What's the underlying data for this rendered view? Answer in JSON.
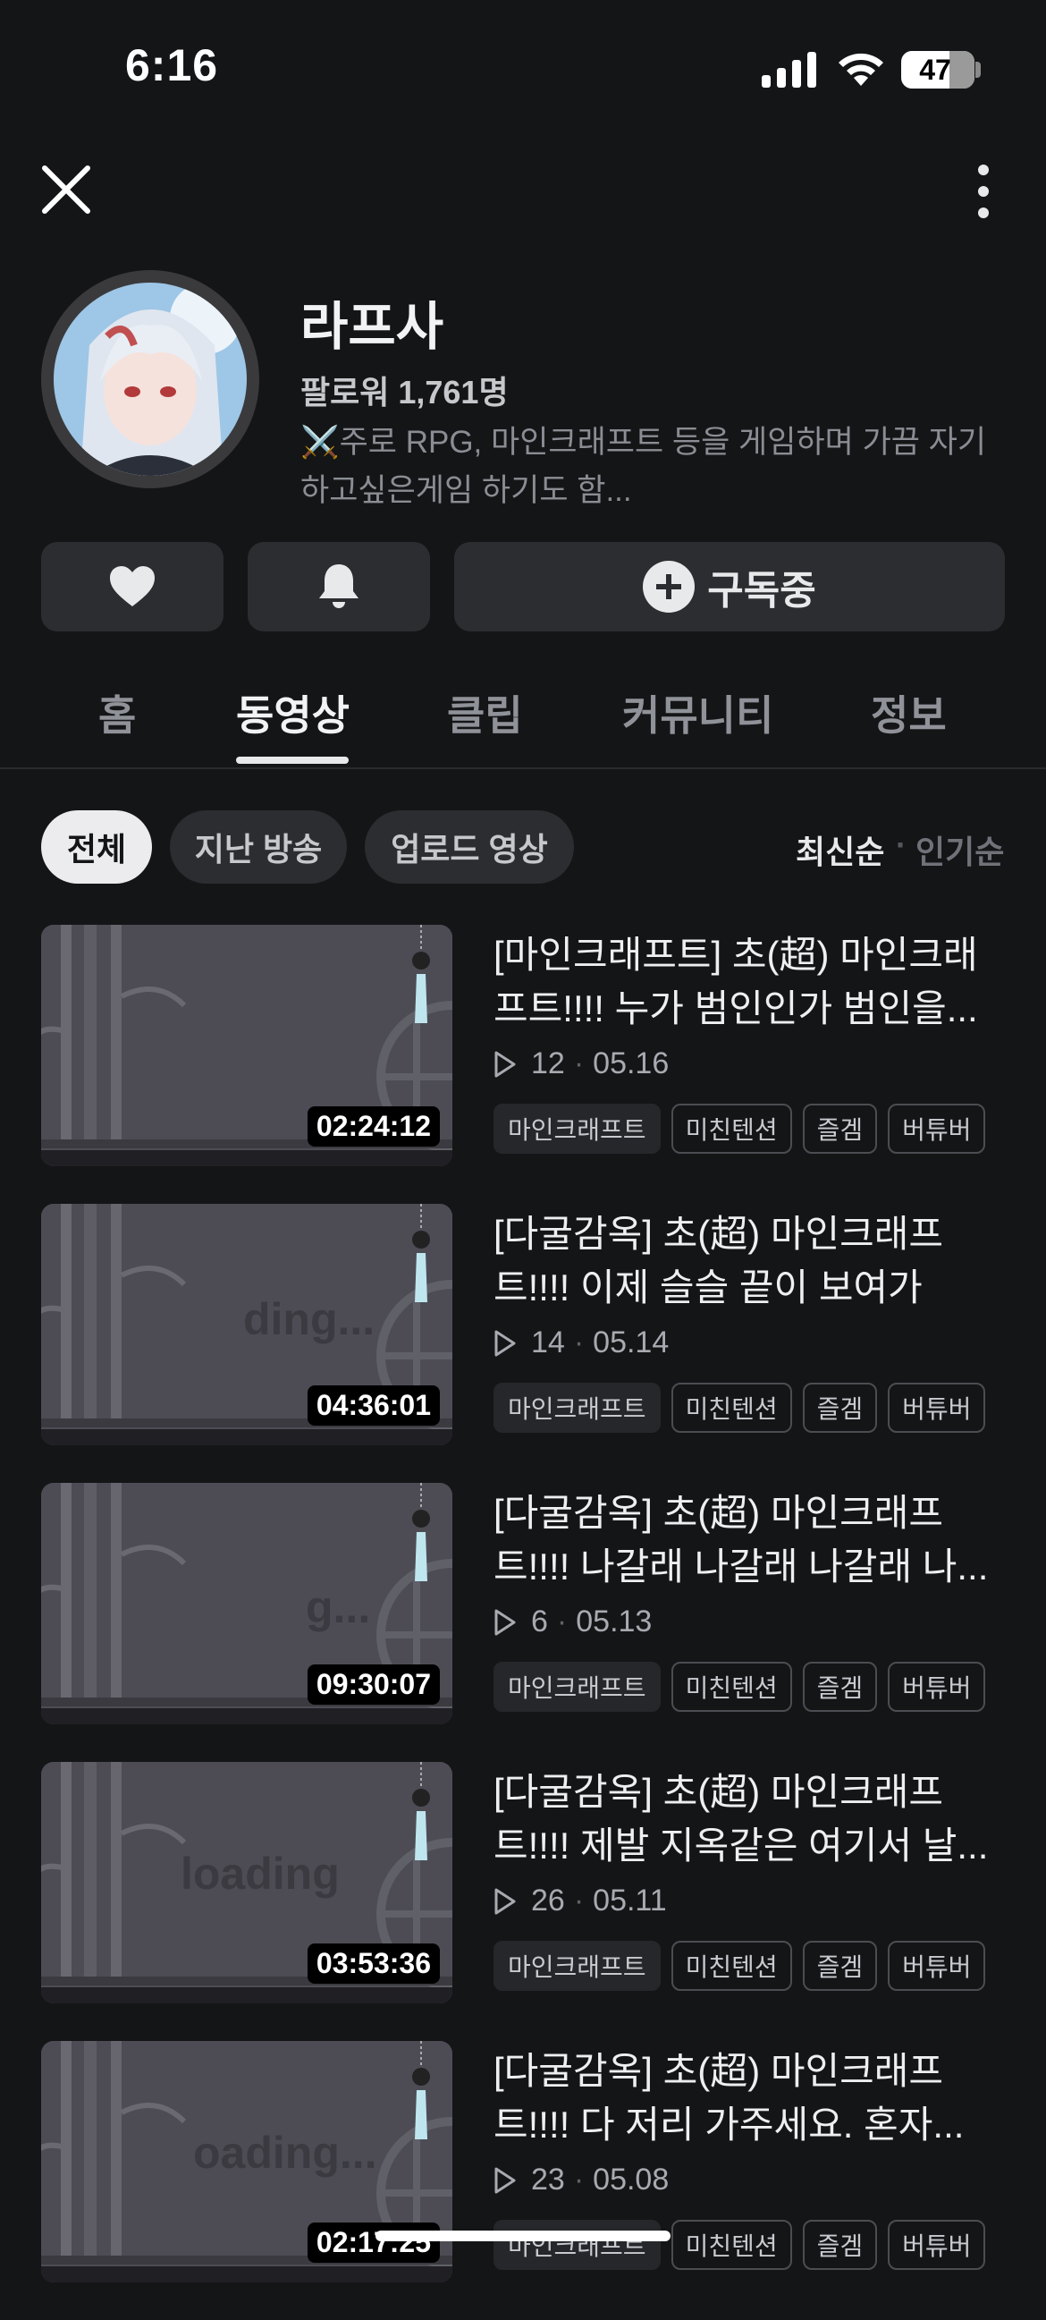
{
  "status": {
    "time": "6:16",
    "battery": "47"
  },
  "channel": {
    "name": "라프사",
    "followers": "팔로워 1,761명",
    "description": "⚔️주로 RPG, 마인크래프트 등을 게임하며 가끔 자기 하고싶은게임 하기도 함..."
  },
  "actions": {
    "subscribe_label": "구독중"
  },
  "tabs": [
    "홈",
    "동영상",
    "클립",
    "커뮤니티",
    "정보"
  ],
  "active_tab": "동영상",
  "filters": [
    "전체",
    "지난 방송",
    "업로드 영상"
  ],
  "sort": {
    "newest": "최신순",
    "separator": "·",
    "popular": "인기순"
  },
  "videos": [
    {
      "title": "[마인크래프트] 초(超) 마인크래프트!!!! 누가 범인인가 범인을...",
      "views": "12",
      "date": "05.16",
      "duration": "02:24:12",
      "overlay": "",
      "tags": [
        "마인크래프트",
        "미친텐션",
        "즐겜",
        "버튜버"
      ]
    },
    {
      "title": "[다굴감옥] 초(超) 마인크래프트!!!! 이제 슬슬 끝이 보여가 희...",
      "views": "14",
      "date": "05.14",
      "duration": "04:36:01",
      "overlay": "ding...",
      "tags": [
        "마인크래프트",
        "미친텐션",
        "즐겜",
        "버튜버"
      ]
    },
    {
      "title": "[다굴감옥] 초(超) 마인크래프트!!!! 나갈래 나갈래 나갈래 나...",
      "views": "6",
      "date": "05.13",
      "duration": "09:30:07",
      "overlay": "g...",
      "tags": [
        "마인크래프트",
        "미친텐션",
        "즐겜",
        "버튜버"
      ]
    },
    {
      "title": "[다굴감옥] 초(超) 마인크래프트!!!! 제발 지옥같은 여기서 날...",
      "views": "26",
      "date": "05.11",
      "duration": "03:53:36",
      "overlay": "loading",
      "tags": [
        "마인크래프트",
        "미친텐션",
        "즐겜",
        "버튜버"
      ]
    },
    {
      "title": "[다굴감옥] 초(超) 마인크래프트!!!! 다 저리 가주세요. 혼자...",
      "views": "23",
      "date": "05.08",
      "duration": "02:17:25",
      "overlay": "oading...",
      "tags": [
        "마인크래프트",
        "미친텐션",
        "즐겜",
        "버튜버"
      ]
    }
  ]
}
